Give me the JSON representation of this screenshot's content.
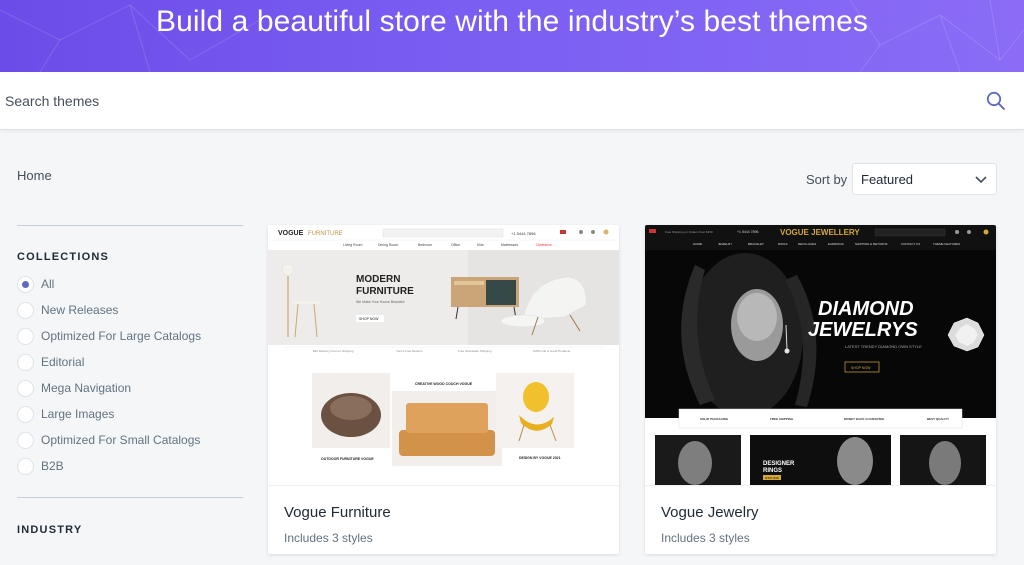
{
  "hero": {
    "title": "Build a beautiful store with the industry’s best themes"
  },
  "search": {
    "placeholder": "Search themes",
    "value": ""
  },
  "breadcrumb": {
    "home": "Home"
  },
  "sort": {
    "label": "Sort by",
    "selected": "Featured"
  },
  "sidebar": {
    "collections_title": "COLLECTIONS",
    "collections": [
      {
        "label": "All",
        "checked": true
      },
      {
        "label": "New Releases",
        "checked": false
      },
      {
        "label": "Optimized For Large Catalogs",
        "checked": false
      },
      {
        "label": "Editorial",
        "checked": false
      },
      {
        "label": "Mega Navigation",
        "checked": false
      },
      {
        "label": "Large Images",
        "checked": false
      },
      {
        "label": "Optimized For Small Catalogs",
        "checked": false
      },
      {
        "label": "B2B",
        "checked": false
      }
    ],
    "industry_title": "INDUSTRY"
  },
  "themes": [
    {
      "name": "Vogue Furniture",
      "styles": "Includes 3 styles",
      "preview": {
        "logo_strong": "VOGUE",
        "logo_light": "FURNITURE",
        "phone": "+1 5444 7896",
        "nav": [
          "Living Room",
          "Dining Room",
          "Bedroom",
          "Office",
          "Kids",
          "Mattresses",
          "Clearance"
        ],
        "hero_line1": "MODERN",
        "hero_line2": "FURNITURE",
        "hero_sub": "We Make Your House Beautiful",
        "hero_button": "SHOP NOW",
        "features": [
          "$40 Delivery Cost on Shipping",
          "You're Free Returns",
          "Free Worldwide Shipping",
          "100% Life & Good Products"
        ],
        "promo_center": "CREATIVE WOOD COUCH VOGUE",
        "promo_left": "OUTDOOR FURNITURE VOGUE",
        "promo_right": "DESIGN BY VOGUE 2021"
      }
    },
    {
      "name": "Vogue Jewelry",
      "styles": "Includes 3 styles",
      "preview": {
        "top_note": "Free Shipping on Orders Over $150",
        "phone": "+1 5444 7896",
        "logo": "VOGUE JEWELLERY",
        "nav": [
          "HOME",
          "JEWELRY",
          "BRACELET",
          "RINGS",
          "NECKLACES",
          "EARRINGS",
          "SHIPPING & RETURNS",
          "CONTACT US",
          "THEME FEATURES"
        ],
        "hero_line1": "DIAMOND",
        "hero_line2": "JEWELRYS",
        "hero_sub": "LATEST TRENDY DIAMOND OWN STYLE",
        "hero_button": "SHOP NOW",
        "features": [
          "SOLID PACKAGING",
          "FREE SHIPPING",
          "MONEY BACK GUARANTEE",
          "BEST QUALITY"
        ],
        "tile_line1": "DESIGNER",
        "tile_line2": "RINGS",
        "tile_button": "SHOP NOW"
      }
    }
  ],
  "colors": {
    "hero_bg": "#7a5ef2",
    "accent": "#5c6ac4"
  }
}
